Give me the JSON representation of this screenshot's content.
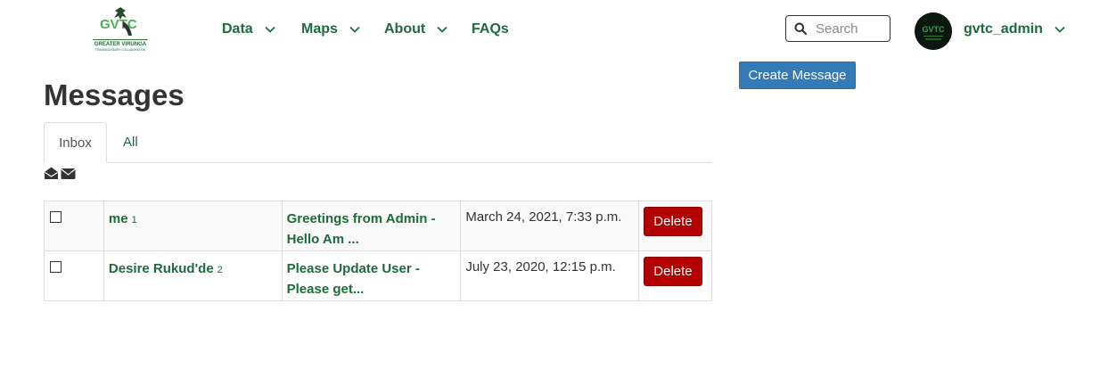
{
  "brand": {
    "logo_text": "GVTC",
    "logo_subtext": "GREATER VIRUNGA",
    "logo_tagline": "TRANSBOUNDARY COLLABORATION",
    "color": "#1e6b3a"
  },
  "nav": [
    {
      "label": "Data",
      "dropdown": true
    },
    {
      "label": "Maps",
      "dropdown": true
    },
    {
      "label": "About",
      "dropdown": true
    },
    {
      "label": "FAQs",
      "dropdown": false
    }
  ],
  "search": {
    "placeholder": "Search",
    "icon": "search-icon"
  },
  "user": {
    "name": "gvtc_admin"
  },
  "create_button": {
    "label": "Create Message",
    "color": "#337ab7"
  },
  "page_title": "Messages",
  "tabs": [
    {
      "label": "Inbox",
      "active": true
    },
    {
      "label": "All",
      "active": false
    }
  ],
  "toolbar": {
    "icons": [
      "envelope-open-icon",
      "envelope-icon"
    ]
  },
  "messages": [
    {
      "sender": "me",
      "count": "1",
      "subject_line1": "Greetings from Admin -",
      "subject_line2": "Hello Am ...",
      "date": "March 24, 2021, 7:33 p.m.",
      "delete_label": "Delete"
    },
    {
      "sender": "Desire Rukud'de",
      "count": "2",
      "subject_line1": "Please Update User -",
      "subject_line2": "Please get...",
      "date": "July 23, 2020, 12:15 p.m.",
      "delete_label": "Delete"
    }
  ],
  "colors": {
    "delete": "#b30000",
    "link": "#1e6b3a"
  }
}
